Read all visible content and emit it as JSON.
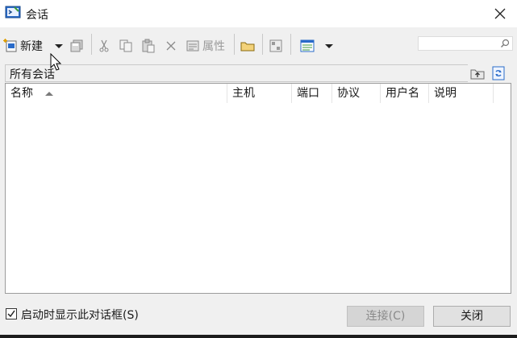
{
  "window": {
    "title": "会话",
    "close_label": "×"
  },
  "toolbar": {
    "new_label": "新建",
    "properties_label": "属性"
  },
  "search": {
    "value": "",
    "placeholder": ""
  },
  "path": {
    "label": "所有会话"
  },
  "table": {
    "columns": [
      "名称",
      "主机",
      "端口",
      "协议",
      "用户名",
      "说明"
    ],
    "sort_column": "名称",
    "sort_direction": "ascending",
    "rows": []
  },
  "footer": {
    "show_on_startup_label": "启动时显示此对话框(S)",
    "show_on_startup_checked": true,
    "connect_label": "连接(C)",
    "close_label": "关闭"
  },
  "icons": {
    "app": "terminal-app-icon",
    "new": "new-session-icon",
    "new_dropdown": "chevron-down-icon",
    "save": "save-icon",
    "cut": "cut-icon",
    "copy": "copy-icon",
    "paste": "paste-icon",
    "delete": "delete-icon",
    "properties": "properties-icon",
    "folder": "folder-icon",
    "shortcut": "shortcut-icon",
    "view": "view-icon",
    "view_dropdown": "chevron-down-icon",
    "search": "search-icon",
    "up_folder": "up-folder-icon",
    "refresh": "refresh-icon"
  },
  "colors": {
    "window_bg": "#f0f0f0",
    "list_bg": "#ffffff",
    "title_bg": "#ffffff"
  }
}
